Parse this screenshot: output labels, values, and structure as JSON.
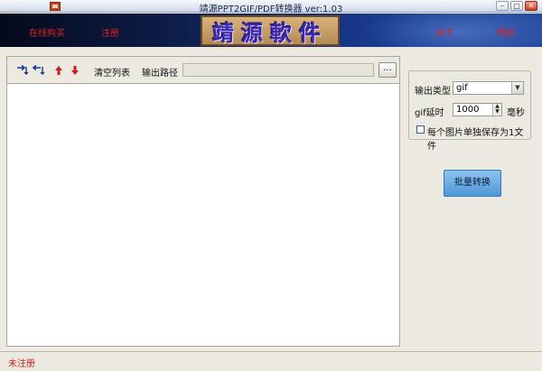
{
  "window": {
    "title": "靖源PPT2GIF/PDF转换器 ver:1.03",
    "controls": {
      "minimize": "–",
      "maximize": "□",
      "close": "✕"
    }
  },
  "banner": {
    "links_left": [
      "在线购买",
      "注册"
    ],
    "logo_text": "靖源軟件",
    "links_right": [
      "关于",
      "帮助"
    ]
  },
  "toolbar": {
    "icons": [
      "add-files-icon",
      "remove-files-icon",
      "move-up-icon",
      "move-down-icon"
    ],
    "clear_list_label": "清空列表",
    "output_path_label": "输出路径",
    "output_path_value": "",
    "browse_label": "..."
  },
  "options": {
    "output_type_label": "输出类型",
    "output_type_value": "gif",
    "gif_delay_label": "gif延时",
    "gif_delay_value": "1000",
    "gif_delay_unit": "毫秒",
    "separate_files_label": "每个图片单独保存为1文件",
    "separate_files_checked": false
  },
  "convert_button_label": "批量转换",
  "status": {
    "text": "未注册"
  },
  "colors": {
    "accent_red": "#c81e1e",
    "button_blue": "#4f97d8"
  }
}
